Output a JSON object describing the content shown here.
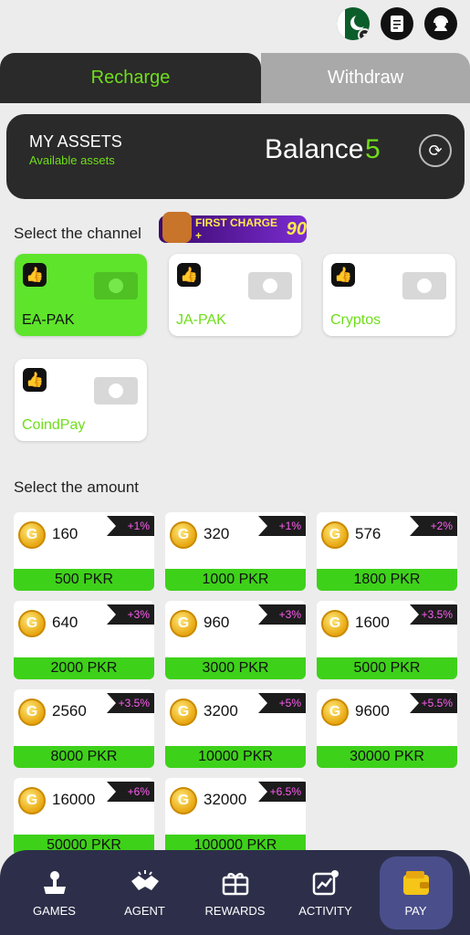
{
  "tabs": {
    "recharge": "Recharge",
    "withdraw": "Withdraw"
  },
  "assets": {
    "title": "MY ASSETS",
    "subtitle": "Available assets",
    "balance_label": "Balance",
    "balance_value": "5"
  },
  "channel_title": "Select the channel",
  "promo": {
    "text": "FIRST CHARGE +",
    "value": "90"
  },
  "channels": [
    {
      "label": "EA-PAK",
      "active": true
    },
    {
      "label": "JA-PAK",
      "active": false
    },
    {
      "label": "Cryptos",
      "active": false
    },
    {
      "label": "CoindPay",
      "active": false
    }
  ],
  "amount_title": "Select the amount",
  "amounts": [
    {
      "coins": "160",
      "bonus": "+1%",
      "pkr": "500 PKR"
    },
    {
      "coins": "320",
      "bonus": "+1%",
      "pkr": "1000 PKR"
    },
    {
      "coins": "576",
      "bonus": "+2%",
      "pkr": "1800 PKR"
    },
    {
      "coins": "640",
      "bonus": "+3%",
      "pkr": "2000 PKR"
    },
    {
      "coins": "960",
      "bonus": "+3%",
      "pkr": "3000 PKR"
    },
    {
      "coins": "1600",
      "bonus": "+3.5%",
      "pkr": "5000 PKR"
    },
    {
      "coins": "2560",
      "bonus": "+3.5%",
      "pkr": "8000 PKR"
    },
    {
      "coins": "3200",
      "bonus": "+5%",
      "pkr": "10000 PKR"
    },
    {
      "coins": "9600",
      "bonus": "+5.5%",
      "pkr": "30000 PKR"
    },
    {
      "coins": "16000",
      "bonus": "+6%",
      "pkr": "50000 PKR"
    },
    {
      "coins": "32000",
      "bonus": "+6.5%",
      "pkr": "100000 PKR"
    }
  ],
  "nav": [
    {
      "label": "GAMES",
      "icon": "joystick-icon"
    },
    {
      "label": "AGENT",
      "icon": "handshake-icon"
    },
    {
      "label": "REWARDS",
      "icon": "gift-icon"
    },
    {
      "label": "ACTIVITY",
      "icon": "activity-chart-icon"
    },
    {
      "label": "PAY",
      "icon": "wallet-icon",
      "active": true
    }
  ],
  "colors": {
    "accent": "#6fde1a",
    "dark": "#2a2a2a",
    "nav": "#2d2f4a",
    "bonus": "#ff5cf2"
  }
}
